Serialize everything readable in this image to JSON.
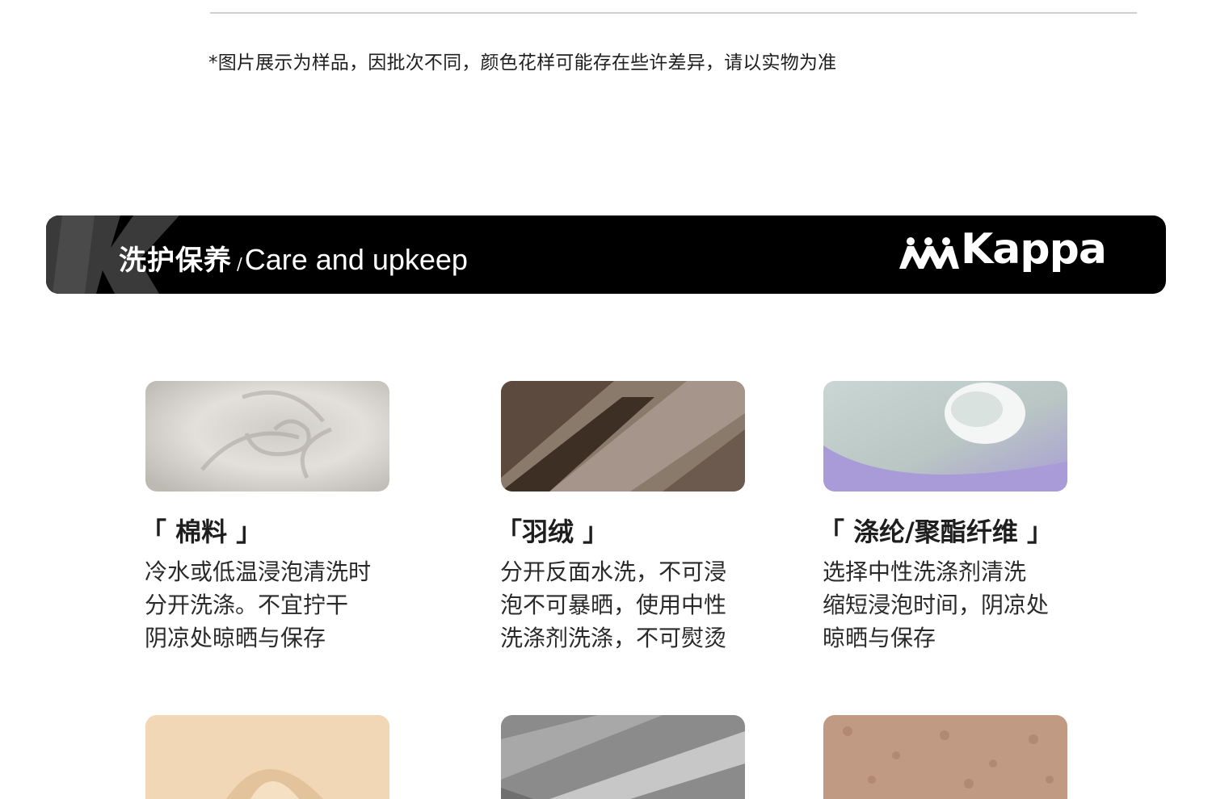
{
  "disclaimer": "*图片展示为样品，因批次不同，颜色花样可能存在些许差异，请以实物为准",
  "banner": {
    "title_cn": "洗护保养",
    "separator": "/",
    "title_en": "Care and upkeep",
    "brand": "Kappa"
  },
  "fabrics": [
    {
      "title": "「 棉料 」",
      "lines": [
        "冷水或低温浸泡清洗时",
        "分开洗涤。不宜拧干",
        "阴凉处晾晒与保存"
      ]
    },
    {
      "title": "「羽绒 」",
      "lines": [
        "分开反面水洗，不可浸",
        "泡不可暴晒，使用中性",
        "洗涤剂洗涤，不可熨烫"
      ]
    },
    {
      "title": "「 涤纶/聚酯纤维 」",
      "lines": [
        "选择中性洗涤剂清洗",
        "缩短浸泡时间，阴凉处",
        "晾晒与保存"
      ]
    }
  ],
  "colors": {
    "banner_bg": "#000000",
    "k_mark": "#3a3a3a",
    "rule": "#cfcfcf"
  }
}
